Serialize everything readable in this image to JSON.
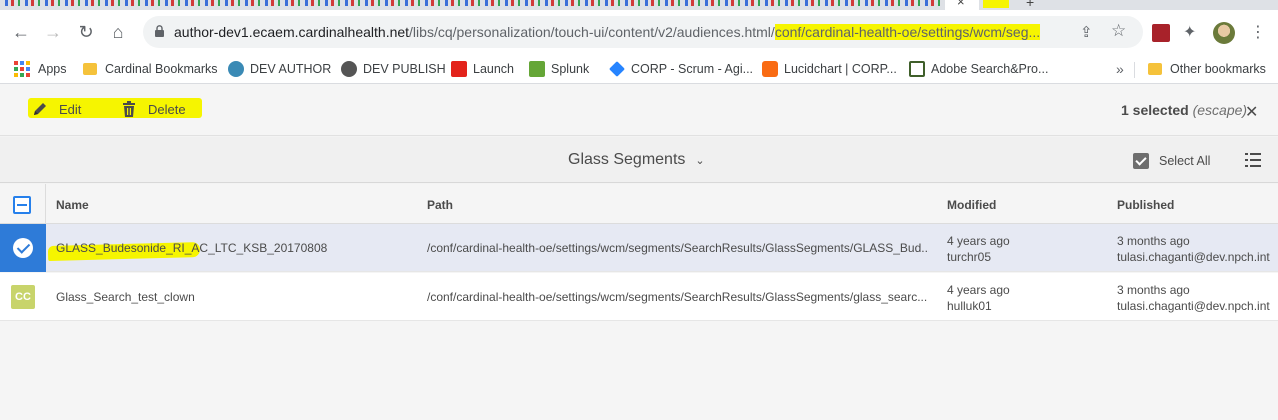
{
  "browser": {
    "address": {
      "host": "author-dev1.ecaem.cardinalhealth.net",
      "path_before": "/libs/cq/personalization/touch-ui/content/v2/audiences.html/",
      "path_highlighted": "conf/cardinal-health-oe/settings/wcm/seg..."
    },
    "bookmarks": [
      {
        "label": "Apps",
        "icon": "apps-grid-icon"
      },
      {
        "label": "Cardinal Bookmarks",
        "icon": "folder-icon"
      },
      {
        "label": "DEV AUTHOR",
        "icon": "aem-icon"
      },
      {
        "label": "DEV PUBLISH",
        "icon": "globe-icon"
      },
      {
        "label": "Launch",
        "icon": "adobe-icon"
      },
      {
        "label": "Splunk",
        "icon": "splunk-icon"
      },
      {
        "label": "CORP - Scrum - Agi...",
        "icon": "jira-icon"
      },
      {
        "label": "Lucidchart | CORP...",
        "icon": "lucidchart-icon"
      },
      {
        "label": "Adobe Search&Pro...",
        "icon": "adobe-search-icon"
      }
    ],
    "other_bookmarks": "Other bookmarks",
    "overflow": "»"
  },
  "actionbar": {
    "edit_label": "Edit",
    "delete_label": "Delete",
    "selected_count": "1 selected",
    "escape_hint": "(escape)"
  },
  "titlebar": {
    "title": "Glass Segments",
    "select_all": "Select All"
  },
  "table": {
    "columns": [
      "Name",
      "Path",
      "Modified",
      "Published"
    ],
    "rows": [
      {
        "name": "GLASS_Budesonide_RI_AC_LTC_KSB_20170808",
        "path": "/conf/cardinal-health-oe/settings/wcm/segments/SearchResults/GlassSegments/GLASS_Bud...",
        "modified": "4 years ago",
        "modified_by": "turchr05",
        "published": "3 months ago",
        "published_by": "tulasi.chaganti@dev.npch.int",
        "selected": true
      },
      {
        "name": "Glass_Search_test_clown",
        "thumb": "CC",
        "path": "/conf/cardinal-health-oe/settings/wcm/segments/SearchResults/GlassSegments/glass_searc...",
        "modified": "4 years ago",
        "modified_by": "hulluk01",
        "published": "3 months ago",
        "published_by": "tulasi.chaganti@dev.npch.int",
        "selected": false
      }
    ]
  },
  "colors": {
    "highlight": "#f6f500",
    "selection_blue": "#2e7bd8",
    "selected_row": "#e6e9f3"
  }
}
